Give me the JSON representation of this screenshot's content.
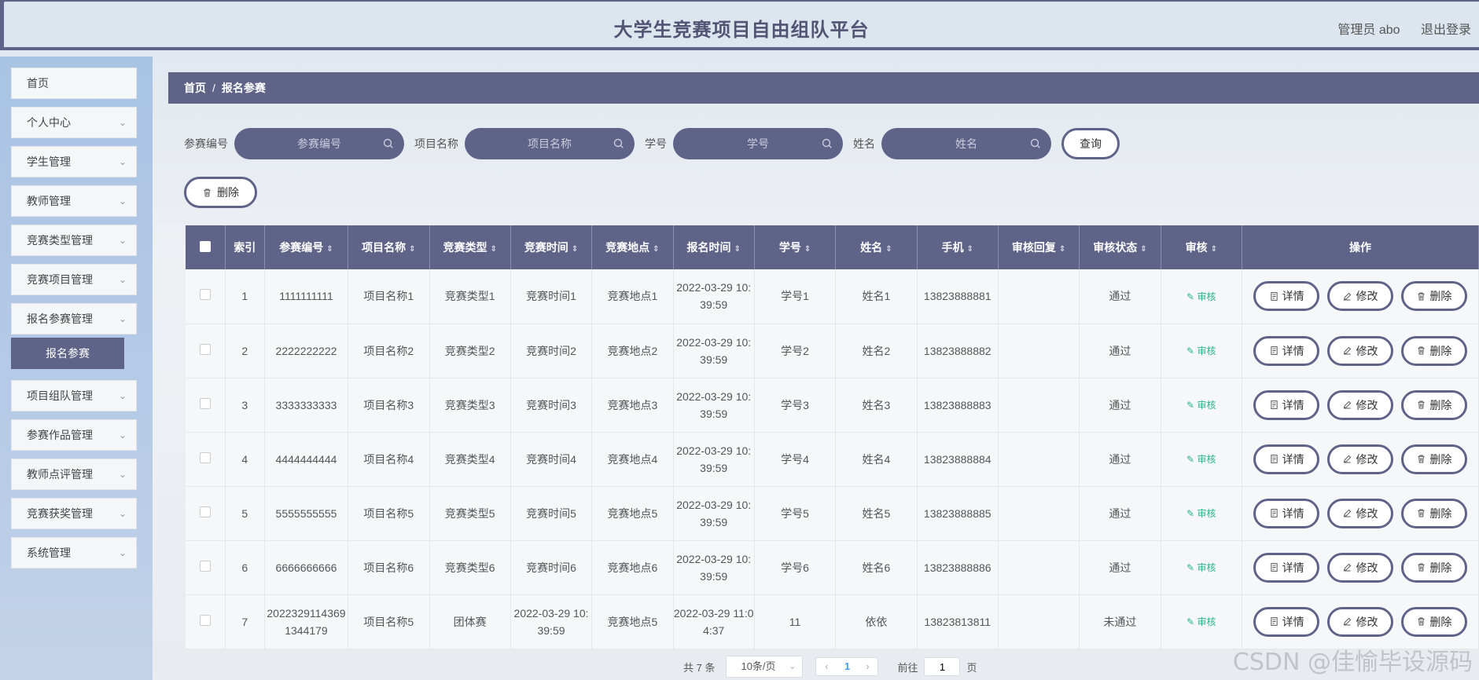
{
  "header": {
    "title": "大学生竞赛项目自由组队平台",
    "user": "管理员 abo",
    "logout": "退出登录"
  },
  "sidebar": {
    "items": [
      {
        "label": "首页",
        "has_children": false
      },
      {
        "label": "个人中心",
        "has_children": true
      },
      {
        "label": "学生管理",
        "has_children": true
      },
      {
        "label": "教师管理",
        "has_children": true
      },
      {
        "label": "竞赛类型管理",
        "has_children": true
      },
      {
        "label": "竞赛项目管理",
        "has_children": true
      },
      {
        "label": "报名参赛管理",
        "has_children": true,
        "submenu": "报名参赛"
      },
      {
        "label": "项目组队管理",
        "has_children": true
      },
      {
        "label": "参赛作品管理",
        "has_children": true
      },
      {
        "label": "教师点评管理",
        "has_children": true
      },
      {
        "label": "竞赛获奖管理",
        "has_children": true
      },
      {
        "label": "系统管理",
        "has_children": true
      }
    ]
  },
  "breadcrumb": {
    "home": "首页",
    "separator": "/",
    "current": "报名参赛"
  },
  "filters": [
    {
      "label": "参赛编号",
      "placeholder": "参赛编号"
    },
    {
      "label": "项目名称",
      "placeholder": "项目名称"
    },
    {
      "label": "学号",
      "placeholder": "学号"
    },
    {
      "label": "姓名",
      "placeholder": "姓名"
    }
  ],
  "buttons": {
    "query": "查询",
    "batch_delete": "删除"
  },
  "table": {
    "columns": [
      {
        "label": "",
        "sortable": false,
        "width": 50
      },
      {
        "label": "索引",
        "sortable": false,
        "width": 50
      },
      {
        "label": "参赛编号",
        "sortable": true,
        "width": 106
      },
      {
        "label": "项目名称",
        "sortable": true,
        "width": 103
      },
      {
        "label": "竞赛类型",
        "sortable": true,
        "width": 103
      },
      {
        "label": "竞赛时间",
        "sortable": true,
        "width": 103
      },
      {
        "label": "竞赛地点",
        "sortable": true,
        "width": 103
      },
      {
        "label": "报名时间",
        "sortable": true,
        "width": 103
      },
      {
        "label": "学号",
        "sortable": true,
        "width": 103
      },
      {
        "label": "姓名",
        "sortable": true,
        "width": 103
      },
      {
        "label": "手机",
        "sortable": true,
        "width": 103
      },
      {
        "label": "审核回复",
        "sortable": true,
        "width": 103
      },
      {
        "label": "审核状态",
        "sortable": true,
        "width": 103
      },
      {
        "label": "审核",
        "sortable": true,
        "width": 103
      },
      {
        "label": "操作",
        "sortable": false,
        "width": 300
      }
    ],
    "rows": [
      [
        "1",
        "1111111111",
        "项目名称1",
        "竞赛类型1",
        "竞赛时间1",
        "竞赛地点1",
        "2022-03-29 10:39:59",
        "学号1",
        "姓名1",
        "13823888881",
        "",
        "通过"
      ],
      [
        "2",
        "2222222222",
        "项目名称2",
        "竞赛类型2",
        "竞赛时间2",
        "竞赛地点2",
        "2022-03-29 10:39:59",
        "学号2",
        "姓名2",
        "13823888882",
        "",
        "通过"
      ],
      [
        "3",
        "3333333333",
        "项目名称3",
        "竞赛类型3",
        "竞赛时间3",
        "竞赛地点3",
        "2022-03-29 10:39:59",
        "学号3",
        "姓名3",
        "13823888883",
        "",
        "通过"
      ],
      [
        "4",
        "4444444444",
        "项目名称4",
        "竞赛类型4",
        "竞赛时间4",
        "竞赛地点4",
        "2022-03-29 10:39:59",
        "学号4",
        "姓名4",
        "13823888884",
        "",
        "通过"
      ],
      [
        "5",
        "5555555555",
        "项目名称5",
        "竞赛类型5",
        "竞赛时间5",
        "竞赛地点5",
        "2022-03-29 10:39:59",
        "学号5",
        "姓名5",
        "13823888885",
        "",
        "通过"
      ],
      [
        "6",
        "6666666666",
        "项目名称6",
        "竞赛类型6",
        "竞赛时间6",
        "竞赛地点6",
        "2022-03-29 10:39:59",
        "学号6",
        "姓名6",
        "13823888886",
        "",
        "通过"
      ],
      [
        "7",
        "20223291143691344179",
        "项目名称5",
        "团体赛",
        "2022-03-29 10:39:59",
        "竞赛地点5",
        "2022-03-29 11:04:37",
        "11",
        "依依",
        "13823813811",
        "",
        "未通过"
      ]
    ],
    "review_link": "审核",
    "actions": {
      "detail": "详情",
      "edit": "修改",
      "delete": "删除"
    }
  },
  "pagination": {
    "total": "共 7 条",
    "page_size": "10条/页",
    "current_page": "1",
    "goto_prefix": "前往",
    "goto_value": "1",
    "goto_suffix": "页"
  },
  "watermark": "CSDN @佳愉毕设源码",
  "colors": {
    "primary": "#5f6388",
    "review_link": "#2bb58a",
    "current_page": "#409eff"
  }
}
